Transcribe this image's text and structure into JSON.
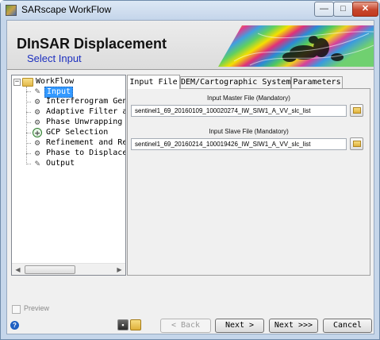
{
  "window": {
    "title": "SARscape WorkFlow",
    "controls": {
      "minimize": "—",
      "maximize": "□",
      "close": "✕"
    }
  },
  "banner": {
    "title": "DInSAR Displacement",
    "subtitle": "Select Input"
  },
  "tree": {
    "root": "WorkFlow",
    "items": [
      {
        "label": "Input",
        "icon": "pencil-icon",
        "selected": true
      },
      {
        "label": "Interferogram Generation",
        "icon": "step-icon"
      },
      {
        "label": "Adaptive Filter and Coherence Generation",
        "icon": "step-icon"
      },
      {
        "label": "Phase Unwrapping",
        "icon": "step-icon"
      },
      {
        "label": "GCP Selection",
        "icon": "add-icon"
      },
      {
        "label": "Refinement and Re-flattening",
        "icon": "step-icon"
      },
      {
        "label": "Phase to Displacement Conversion and Geocoding",
        "icon": "step-icon"
      },
      {
        "label": "Output",
        "icon": "pencil-icon"
      }
    ]
  },
  "tabs": [
    {
      "label": "Input File",
      "active": true
    },
    {
      "label": "DEM/Cartographic System",
      "active": false
    },
    {
      "label": "Parameters",
      "active": false
    }
  ],
  "fields": {
    "master": {
      "label": "Input Master File (Mandatory)",
      "value": "sentinel1_69_20160109_100020274_IW_SIW1_A_VV_slc_list"
    },
    "slave": {
      "label": "Input Slave File (Mandatory)",
      "value": "sentinel1_69_20160214_100019426_IW_SIW1_A_VV_slc_list"
    }
  },
  "footer": {
    "preview_label": "Preview",
    "back": "< Back",
    "next": "Next >",
    "next_all": "Next >>>",
    "cancel": "Cancel"
  }
}
